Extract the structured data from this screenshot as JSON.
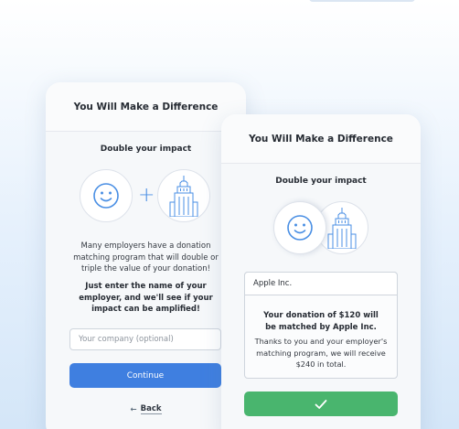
{
  "background": {
    "gradient_start": "#ffffff",
    "gradient_end": "#d4e6f8"
  },
  "colors": {
    "accent_blue": "#3f7fe0",
    "success_green": "#49b56e",
    "icon_blue": "#4a8fe4"
  },
  "left_card": {
    "title": "You Will Make a Difference",
    "subtitle": "Double your impact",
    "icons": {
      "left": "smiley-face-icon",
      "right": "skyscraper-icon",
      "joiner": "+"
    },
    "description": "Many employers have a donation matching program that will double or triple the value of your donation!",
    "instruction": "Just enter the name of your employer, and we'll see if your impact can be amplified!",
    "company_input": {
      "value": "",
      "placeholder": "Your company (optional)"
    },
    "continue_label": "Continue",
    "back_label": "Back"
  },
  "right_card": {
    "title": "You Will Make a Difference",
    "subtitle": "Double your impact",
    "icons": {
      "left": "smiley-face-icon",
      "right": "skyscraper-icon"
    },
    "company_input": {
      "value": "Apple Inc."
    },
    "match_headline": "Your donation of $120 will be matched by Apple Inc.",
    "match_detail": "Thanks to you and your employer's matching program, we will receive $240 in total.",
    "confirm_icon": "checkmark-icon"
  }
}
